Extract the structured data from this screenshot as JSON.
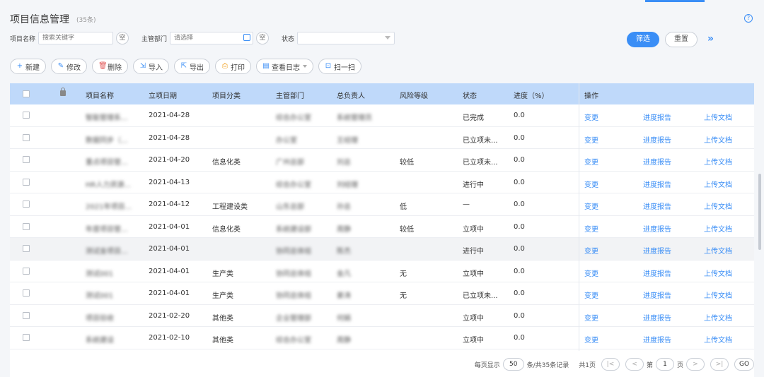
{
  "page": {
    "title": "项目信息管理",
    "count": "(35条)",
    "help_icon": "?"
  },
  "filters": {
    "name_label": "项目名称",
    "name_placeholder": "搜索关键字",
    "clear_label": "空",
    "dept_label": "主管部门",
    "dept_placeholder": "请选择",
    "status_label": "状态",
    "status_value": ""
  },
  "actions": {
    "filter_label": "筛选",
    "reset_label": "重置",
    "expand_label": "»"
  },
  "toolbar": [
    {
      "label": "新建",
      "icon": "plus-icon",
      "glyph": "+"
    },
    {
      "label": "修改",
      "icon": "edit-icon",
      "glyph": "✎"
    },
    {
      "label": "删除",
      "icon": "trash-icon",
      "glyph": "🗑"
    },
    {
      "label": "导入",
      "icon": "import-icon",
      "glyph": "⇲"
    },
    {
      "label": "导出",
      "icon": "export-icon",
      "glyph": "⇱"
    },
    {
      "label": "打印",
      "icon": "print-icon",
      "glyph": "⎙"
    },
    {
      "label": "查看日志",
      "icon": "log-icon",
      "glyph": "▤"
    },
    {
      "label": "扫一扫",
      "icon": "scan-icon",
      "glyph": "⊡"
    }
  ],
  "table": {
    "headers": [
      "项目名称",
      "立项日期",
      "项目分类",
      "主管部门",
      "总负责人",
      "风险等级",
      "状态",
      "进度（%）",
      "操作"
    ],
    "op_labels": [
      "变更",
      "进度报告",
      "上传文档"
    ],
    "rows": [
      {
        "name": "智能管理系...",
        "date": "2021-04-28",
        "category": "",
        "dept": "综合办公室",
        "owner": "系统管理员",
        "risk": "",
        "status": "已完成",
        "progress": "0.0"
      },
      {
        "name": "数据同步（...",
        "date": "2021-04-28",
        "category": "",
        "dept": "办公室",
        "owner": "王经理",
        "risk": "",
        "status": "已立项未...",
        "progress": "0.0"
      },
      {
        "name": "重点项目管...",
        "date": "2021-04-20",
        "category": "信息化类",
        "dept": "广州总部",
        "owner": "刘总",
        "risk": "较低",
        "status": "已立项未...",
        "progress": "0.0"
      },
      {
        "name": "HR人力资源...",
        "date": "2021-04-13",
        "category": "",
        "dept": "综合办公室",
        "owner": "刘经理",
        "risk": "",
        "status": "进行中",
        "progress": "0.0"
      },
      {
        "name": "2021年项目...",
        "date": "2021-04-12",
        "category": "工程建设类",
        "dept": "山东总部",
        "owner": "孙总",
        "risk": "低",
        "status": "—",
        "progress": "0.0"
      },
      {
        "name": "年度项目管...",
        "date": "2021-04-01",
        "category": "信息化类",
        "dept": "系统建设部",
        "owner": "周静",
        "risk": "较低",
        "status": "立项中",
        "progress": "0.0"
      },
      {
        "name": "测试金项目...",
        "date": "2021-04-01",
        "category": "",
        "dept": "协同总体组",
        "owner": "陈杰",
        "risk": "",
        "status": "进行中",
        "progress": "0.0"
      },
      {
        "name": "测试001",
        "date": "2021-04-01",
        "category": "生产类",
        "dept": "协同总体组",
        "owner": "金凡",
        "risk": "无",
        "status": "立项中",
        "progress": "0.0"
      },
      {
        "name": "测试001",
        "date": "2021-04-01",
        "category": "生产类",
        "dept": "协同总体组",
        "owner": "姜涛",
        "risk": "无",
        "status": "已立项未...",
        "progress": "0.0"
      },
      {
        "name": "项目验收",
        "date": "2021-02-20",
        "category": "其他类",
        "dept": "企业管理部",
        "owner": "何娟",
        "risk": "",
        "status": "立项中",
        "progress": "0.0"
      },
      {
        "name": "系统建设",
        "date": "2021-02-10",
        "category": "其他类",
        "dept": "综合办公室",
        "owner": "周静",
        "risk": "",
        "status": "立项中",
        "progress": "0.0"
      }
    ]
  },
  "pager": {
    "per_page_label": "每页显示",
    "per_page": "50",
    "total_label": "条/共35条记录",
    "pages_label": "共1页",
    "first": "|<",
    "prev": "<",
    "page_prefix": "第",
    "page": "1",
    "page_suffix": "页",
    "next": ">",
    "last": ">|",
    "go": "GO"
  }
}
